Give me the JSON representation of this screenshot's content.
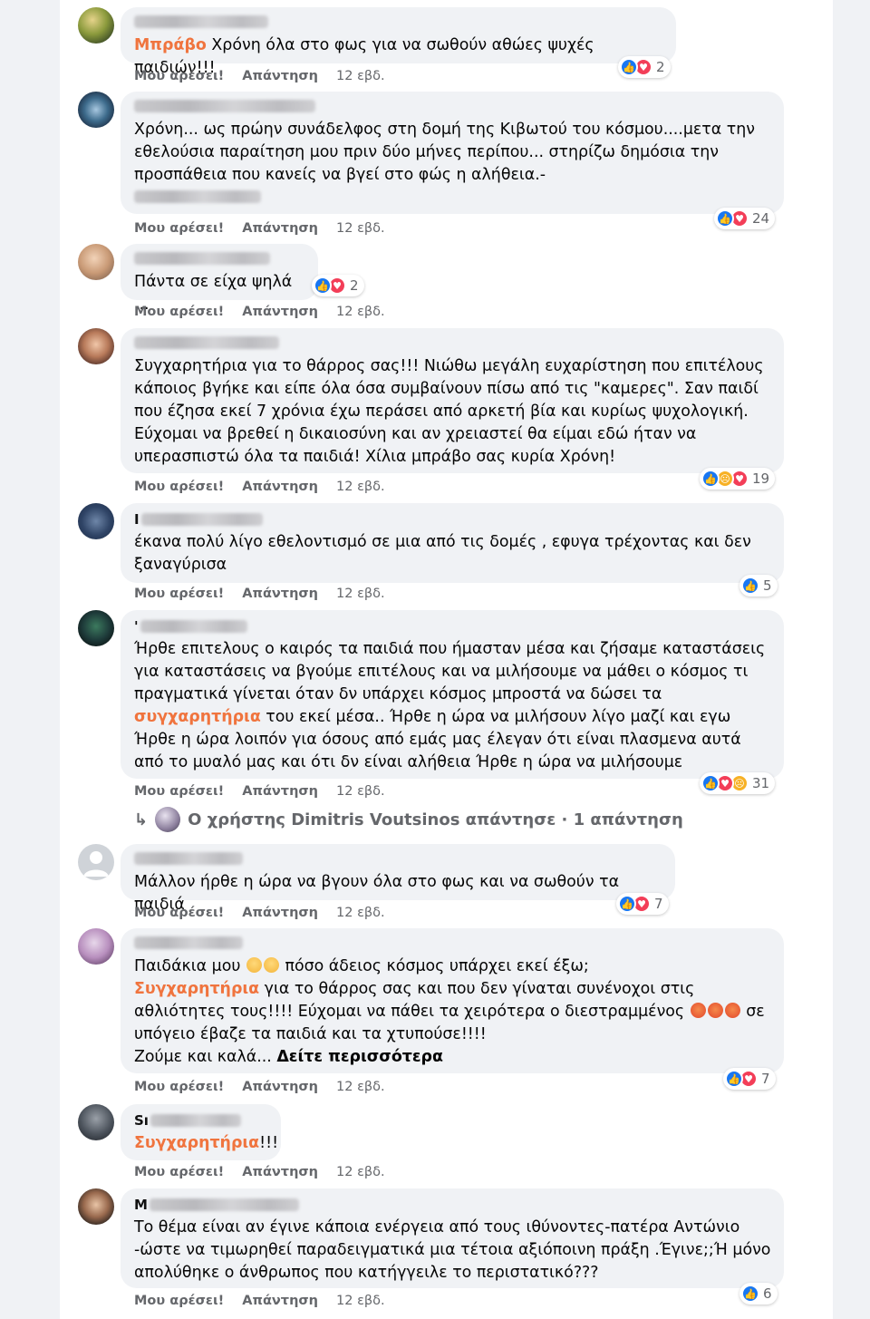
{
  "ui": {
    "like_label": "Μου αρέσει!",
    "reply_label": "Απάντηση",
    "time_label": "12 εβδ.",
    "accent": "#f0743e",
    "secondary_text": "#65676b"
  },
  "comments": [
    {
      "text_highlight": "Μπράβο",
      "text": " Χρόνη όλα στο φως για να σωθούν αθώες ψυχές παιδιών!!!",
      "reactions": [
        "like-icon",
        "love-icon"
      ],
      "reaction_count": "2"
    },
    {
      "text": "Χρόνη... ως πρώην συνάδελφος στη δομή της Κιβωτού του κόσμου....μετα την εθελούσια παραίτηση μου πριν δύο μήνες περίπου... στηρίζω δημόσια την προσπάθεια που κανείς να βγεί στο φώς η αλήθεια.-",
      "reactions": [
        "like-icon",
        "love-icon"
      ],
      "reaction_count": "24"
    },
    {
      "text": "Πάντα σε είχα ψηλά ...",
      "reactions": [
        "like-icon",
        "love-icon"
      ],
      "reaction_count": "2"
    },
    {
      "text": "Συγχαρητήρια για το θάρρος σας!!! Νιώθω μεγάλη ευχαρίστηση που επιτέλους κάποιος βγήκε και είπε όλα όσα συμβαίνουν πίσω από τις \"καμερες\". Σαν παιδί που έζησα εκεί 7 χρόνια έχω περάσει από αρκετή βία και κυρίως ψυχολογική. Εύχομαι να βρεθεί η δικαιοσύνη και αν χρειαστεί θα είμαι εδώ ήταν να υπερασπιστώ όλα τα παιδιά! Χίλια μπράβο σας κυρία Χρόνη!",
      "reactions": [
        "like-icon",
        "sad-icon",
        "love-icon"
      ],
      "reaction_count": "19"
    },
    {
      "name_initial": "I",
      "text": "έκανα πολύ λίγο εθελοντισμό σε μια από τις δομές , εφυγα τρέχοντας και δεν ξαναγύρισα",
      "reactions": [
        "like-icon"
      ],
      "reaction_count": "5"
    },
    {
      "name_initial": "'",
      "text_before": "Ήρθε επιτελους ο καιρός τα παιδιά που ήμασταν μέσα και ζήσαμε καταστάσεις για καταστάσεις να βγούμε επιτέλους και να μιλήσουμε να μάθει ο κόσμος τι πραγματικά γίνεται όταν δν υπάρχει κόσμος μπροστά να δώσει τα ",
      "text_highlight": "συγχαρητήρια",
      "text_after": " του εκεί μέσα.. Ήρθε η ώρα να μιλήσουν λίγο μαζί και εγω Ήρθε η ώρα λοιπόν για όσους από εμάς μας έλεγαν ότι είναι πλασμενα αυτά από το μυαλό μας και ότι δν είναι αλήθεια Ήρθε η ώρα να μιλήσουμε",
      "reactions": [
        "like-icon",
        "love-icon",
        "sad-icon"
      ],
      "reaction_count": "31",
      "reply_summary": "Ο χρήστης Dimitris Voutsinos απάντησε · 1 απάντηση"
    },
    {
      "text": "Μάλλον ήρθε η ώρα να βγουν όλα στο φως και να σωθούν τα παιδιά",
      "reactions": [
        "like-icon",
        "love-icon"
      ],
      "reaction_count": "7"
    },
    {
      "text_line1": "Παιδάκια μου",
      "text_line1b": " πόσο άδειος κόσμος υπάρχει εκεί έξω;",
      "text_highlight": "Συγχαρητήρια",
      "text_mid": " για το θάρρος σας και που δεν γίναται συνένοχοι στις αθλιότητες τους!!!! Εύχομαι να πάθει τα χειρότερα ο διεστραμμένος",
      "text_mid2": " σε υπόγειο έβαζε τα παιδιά και τα χτυπούσε!!!!",
      "text_end": "Ζούμε και καλά... ",
      "see_more": "Δείτε περισσότερα",
      "reactions": [
        "like-icon",
        "love-icon"
      ],
      "reaction_count": "7"
    },
    {
      "name_initial": "Sı",
      "text_highlight": "Συγχαρητήρια",
      "text": "!!!"
    },
    {
      "name_initial": "M",
      "text": "Το θέμα είναι αν έγινε κάποια ενέργεια από τους ιθύνοντες-πατέρα Αντώνιο -ώστε να τιμωρηθεί παραδειγματικά μια τέτοια αξιόποινη πράξη .Έγινε;;Ή μόνο απολύθηκε ο άνθρωπος που κατήγγειλε το περιστατικό???",
      "reactions": [
        "like-icon"
      ],
      "reaction_count": "6"
    }
  ]
}
